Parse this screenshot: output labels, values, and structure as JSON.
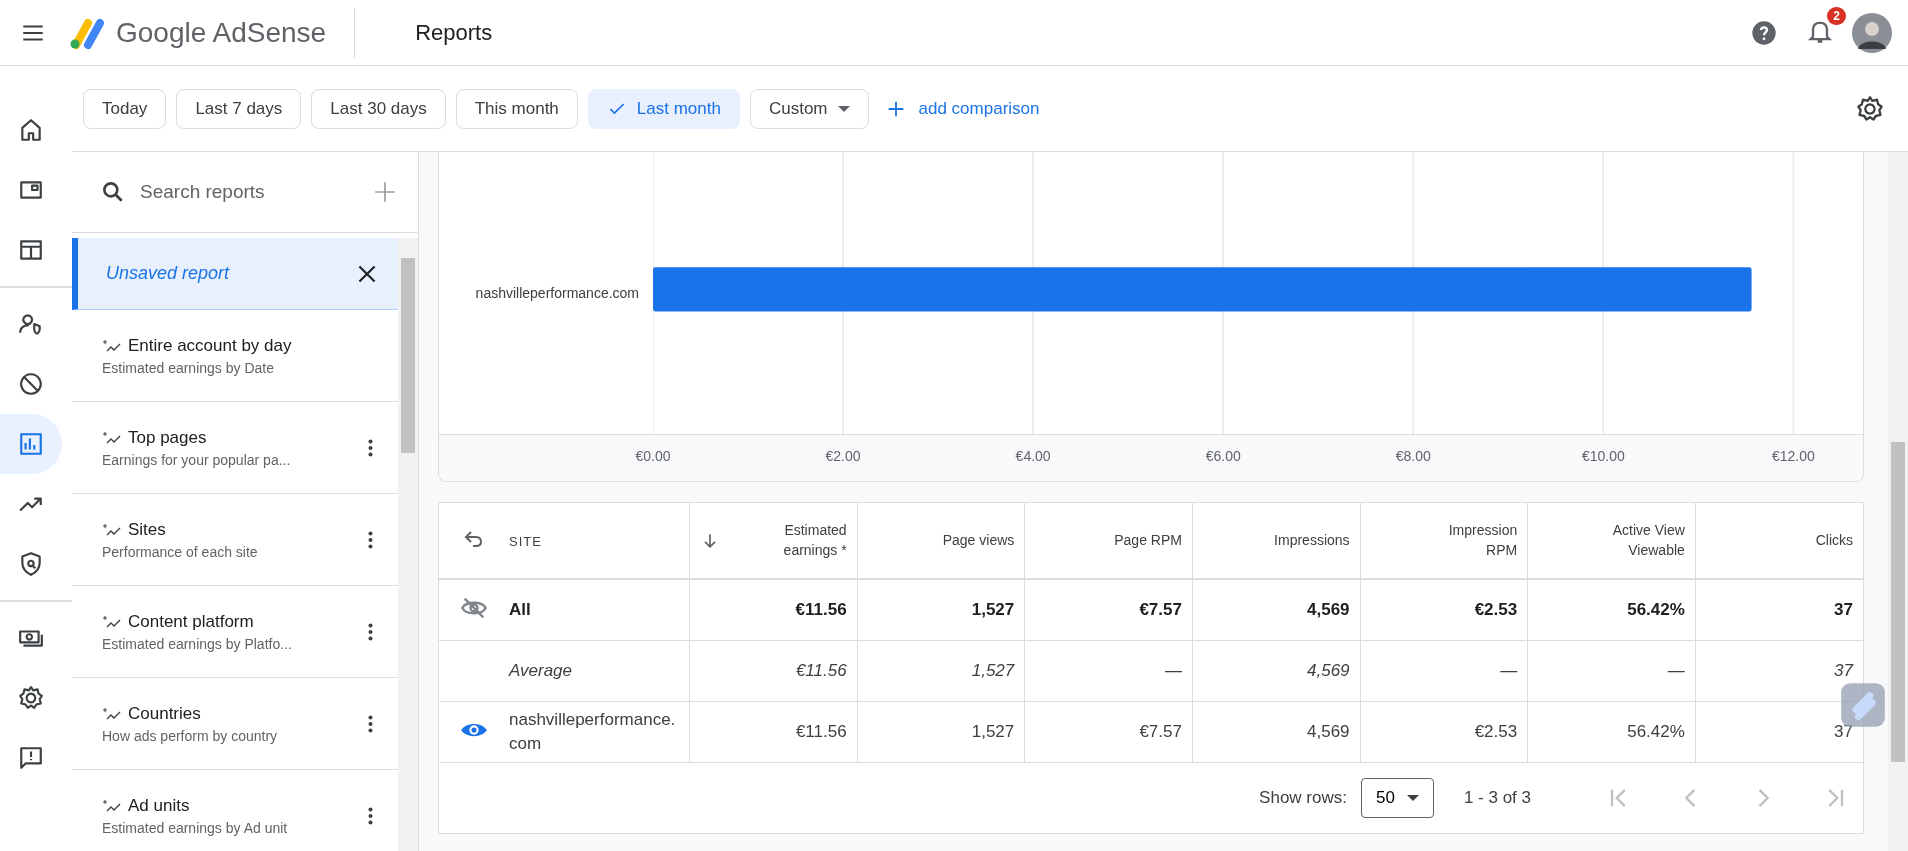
{
  "app_bar": {
    "brand": "Google AdSense",
    "page_title": "Reports",
    "notification_count": "2"
  },
  "nav_rail": [
    {
      "kind": "home",
      "selected": false
    },
    {
      "kind": "ads",
      "selected": false
    },
    {
      "kind": "layout",
      "selected": false
    },
    {
      "kind": "divider"
    },
    {
      "kind": "privacy",
      "selected": false
    },
    {
      "kind": "block",
      "selected": false
    },
    {
      "kind": "reports",
      "selected": true
    },
    {
      "kind": "trend",
      "selected": false
    },
    {
      "kind": "shield",
      "selected": false
    },
    {
      "kind": "divider"
    },
    {
      "kind": "payments",
      "selected": false
    },
    {
      "kind": "settings",
      "selected": false
    },
    {
      "kind": "feedback",
      "selected": false
    }
  ],
  "date_filters": [
    {
      "label": "Today",
      "selected": false
    },
    {
      "label": "Last 7 days",
      "selected": false
    },
    {
      "label": "Last 30 days",
      "selected": false
    },
    {
      "label": "This month",
      "selected": false
    },
    {
      "label": "Last month",
      "selected": true
    }
  ],
  "custom_dropdown": "Custom",
  "add_comparison": "add comparison",
  "report_list": {
    "search": {
      "placeholder": "Search reports"
    },
    "items": [
      {
        "kind": "unsaved",
        "title": "Unsaved report",
        "selected": true
      },
      {
        "kind": "saved",
        "title": "Entire account by day",
        "subtitle": "Estimated earnings by Date",
        "selected": false,
        "menu": false
      },
      {
        "kind": "saved",
        "title": "Top pages",
        "subtitle": "Earnings for your popular pa...",
        "selected": false,
        "menu": true
      },
      {
        "kind": "saved",
        "title": "Sites",
        "subtitle": "Performance of each site",
        "selected": false,
        "menu": true
      },
      {
        "kind": "saved",
        "title": "Content platform",
        "subtitle": "Estimated earnings by Platfo...",
        "selected": false,
        "menu": true
      },
      {
        "kind": "saved",
        "title": "Countries",
        "subtitle": "How ads perform by country",
        "selected": false,
        "menu": true
      },
      {
        "kind": "saved",
        "title": "Ad units",
        "subtitle": "Estimated earnings by Ad unit",
        "selected": false,
        "menu": true
      }
    ]
  },
  "chart": {
    "chart_data": {
      "type": "bar",
      "orientation": "horizontal",
      "grid": true,
      "categories": [
        "nashvilleperformance.com"
      ],
      "series": [
        {
          "color": "#1a73e8",
          "values": [
            11.56
          ]
        }
      ],
      "xlim": [
        0,
        12
      ],
      "xticks": [
        {
          "value": 0,
          "label": "€0.00"
        },
        {
          "value": 2,
          "label": "€2.00"
        },
        {
          "value": 4,
          "label": "€4.00"
        },
        {
          "value": 6,
          "label": "€6.00"
        },
        {
          "value": 8,
          "label": "€8.00"
        },
        {
          "value": 10,
          "label": "€10.00"
        },
        {
          "value": 12,
          "label": "€12.00"
        }
      ]
    }
  },
  "table": {
    "columns": [
      "SITE",
      "Estimated earnings *",
      "Page views",
      "Page RPM",
      "Impressions",
      "Impression RPM",
      "Active View Viewable",
      "Clicks"
    ],
    "rows": [
      {
        "kind": "total",
        "visible": false,
        "cells": [
          "All",
          "€11.56",
          "1,527",
          "€7.57",
          "4,569",
          "€2.53",
          "56.42%",
          "37"
        ]
      },
      {
        "kind": "average",
        "cells": [
          "Average",
          "€11.56",
          "1,527",
          "—",
          "4,569",
          "—",
          "—",
          "37"
        ]
      },
      {
        "kind": "site",
        "visible": true,
        "cells": [
          "nashvilleperformance.com",
          "€11.56",
          "1,527",
          "€7.57",
          "4,569",
          "€2.53",
          "56.42%",
          "37"
        ]
      }
    ],
    "footer": {
      "show_rows_label": "Show rows:",
      "rows_per_page": "50",
      "range": "1 - 3 of 3"
    }
  }
}
